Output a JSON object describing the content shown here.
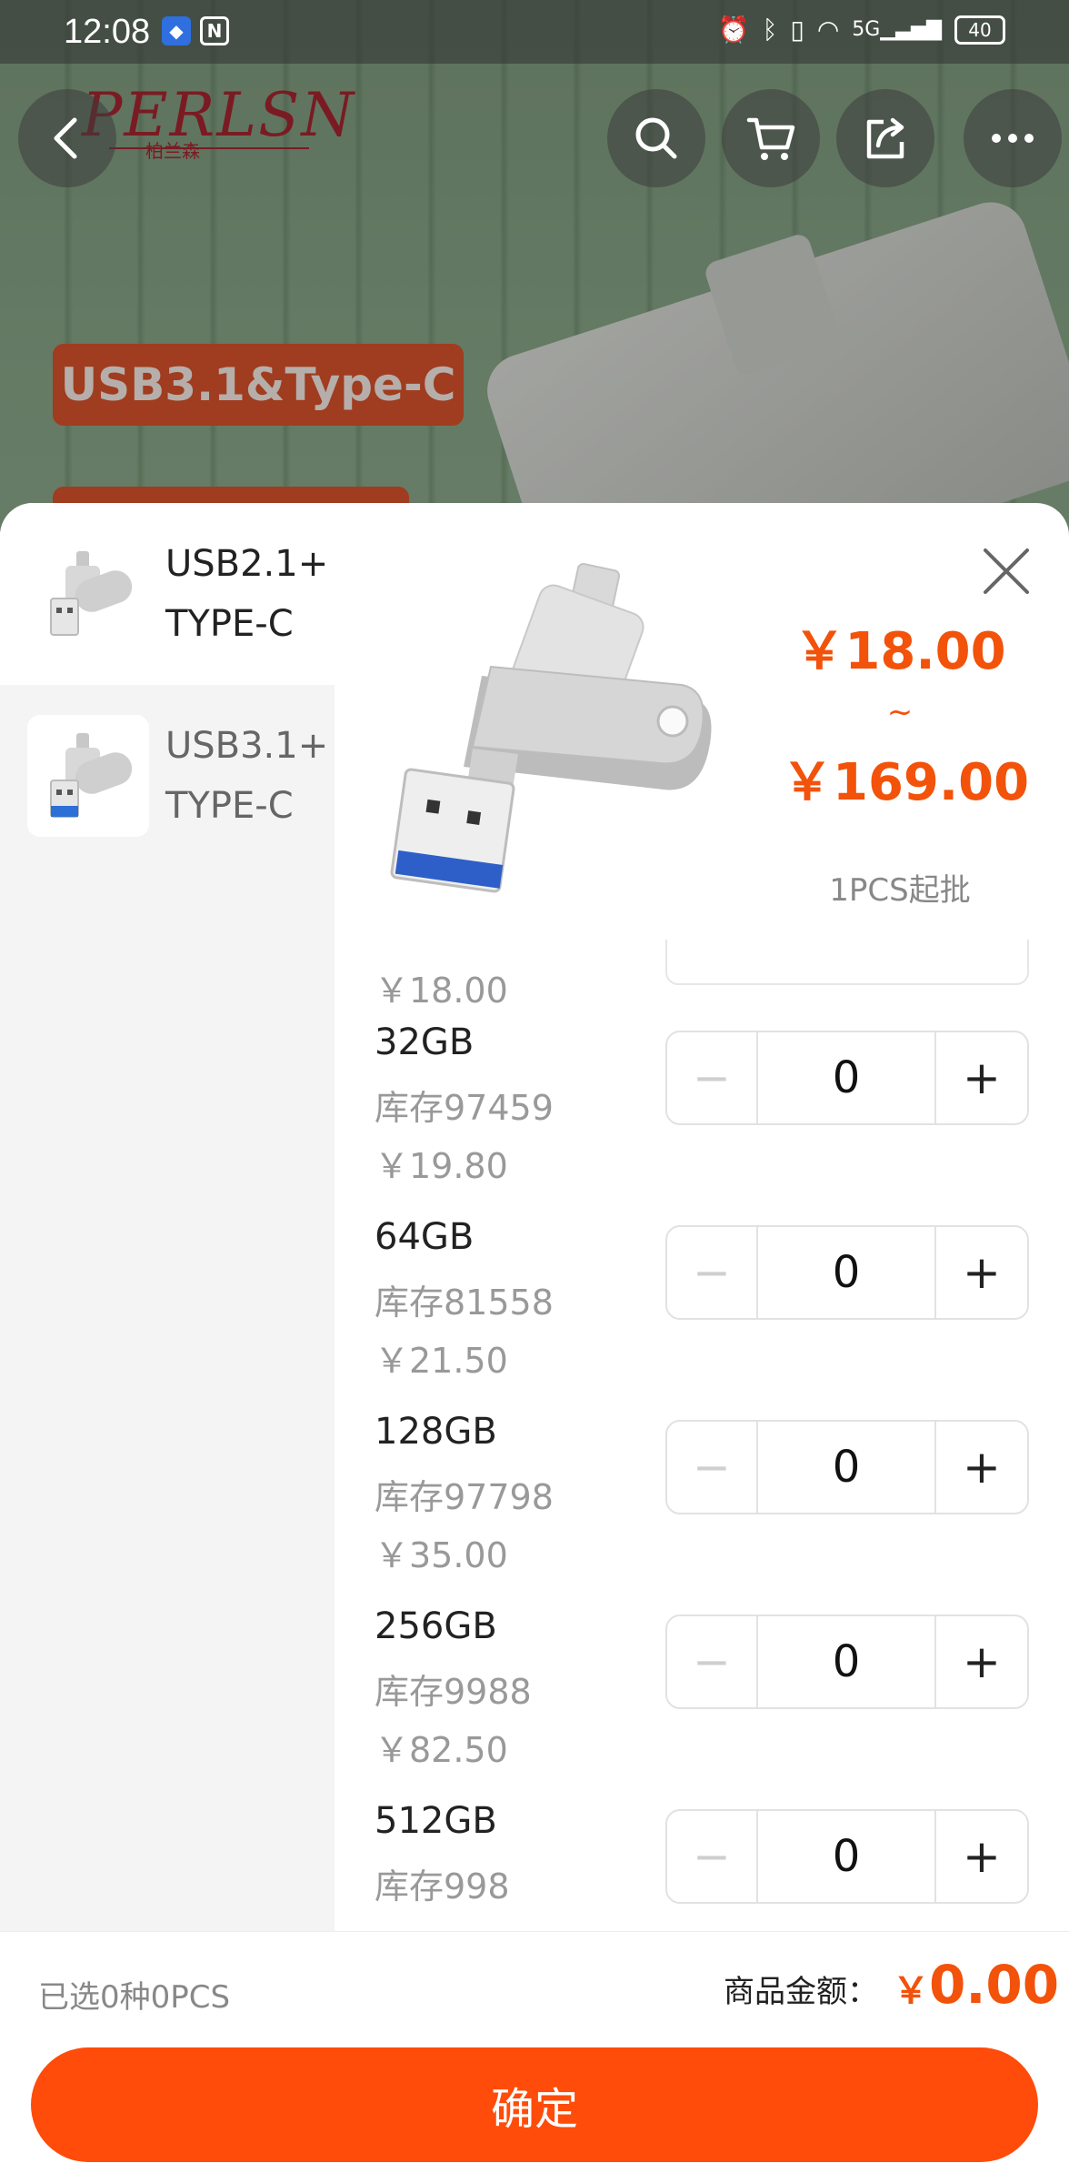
{
  "status_bar": {
    "time": "12:08",
    "battery": "40",
    "signal": "5G"
  },
  "banner": {
    "brand_logo": "PERLSN",
    "brand_logo_sub": "柏兰森",
    "feature_tag": "USB3.1&Type-C"
  },
  "top_actions": {
    "icons": [
      "back-icon",
      "search-icon",
      "cart-icon",
      "share-icon",
      "more-icon"
    ]
  },
  "variants": [
    {
      "label": "USB2.1+\nTYPE-C",
      "line1": "USB2.1+",
      "line2": "TYPE-C",
      "selected": true
    },
    {
      "label": "USB3.1+\nTYPE-C",
      "line1": "USB3.1+",
      "line2": "TYPE-C",
      "selected": false
    }
  ],
  "price": {
    "low": "￥18.00",
    "separator": "~",
    "high": "￥169.00",
    "min_order": "1PCS起批"
  },
  "sku_partial": {
    "price": "￥18.00"
  },
  "skus": [
    {
      "size": "32GB",
      "stock": "库存97459",
      "price": "￥19.80",
      "qty": "0"
    },
    {
      "size": "64GB",
      "stock": "库存81558",
      "price": "￥21.50",
      "qty": "0"
    },
    {
      "size": "128GB",
      "stock": "库存97798",
      "price": "￥35.00",
      "qty": "0"
    },
    {
      "size": "256GB",
      "stock": "库存9988",
      "price": "￥82.50",
      "qty": "0"
    },
    {
      "size": "512GB",
      "stock": "库存998",
      "price": "",
      "qty": "0"
    }
  ],
  "stepper": {
    "minus": "−",
    "plus": "+"
  },
  "footer": {
    "selected_summary": "已选0种0PCS",
    "total_label": "商品金额：",
    "total_currency": "￥",
    "total_value": "0.00",
    "confirm": "确定"
  },
  "colors": {
    "accent": "#ff4c0a",
    "price": "#f2520a"
  }
}
